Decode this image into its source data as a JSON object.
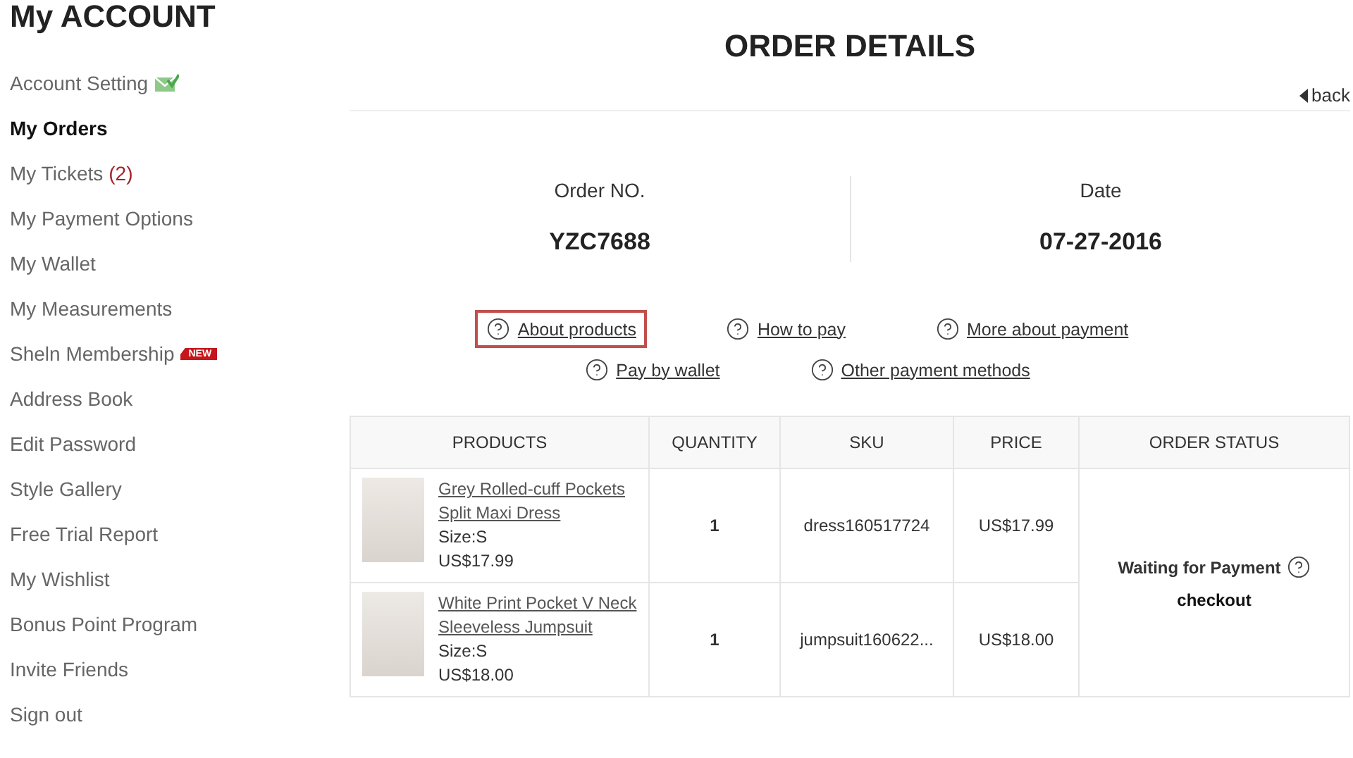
{
  "sidebar": {
    "title": "My ACCOUNT",
    "items": [
      {
        "label": "Account Setting",
        "kind": "mail",
        "selected": false
      },
      {
        "label": "My Orders",
        "kind": "plain",
        "selected": true
      },
      {
        "label": "My Tickets",
        "kind": "count",
        "count": "(2)",
        "selected": false
      },
      {
        "label": "My Payment Options",
        "kind": "plain",
        "selected": false
      },
      {
        "label": "My Wallet",
        "kind": "plain",
        "selected": false
      },
      {
        "label": "My Measurements",
        "kind": "plain",
        "selected": false
      },
      {
        "label": "Sheln Membership",
        "kind": "badge",
        "badge": "NEW",
        "selected": false
      },
      {
        "label": "Address Book",
        "kind": "plain",
        "selected": false
      },
      {
        "label": "Edit Password",
        "kind": "plain",
        "selected": false
      },
      {
        "label": "Style Gallery",
        "kind": "plain",
        "selected": false
      },
      {
        "label": "Free Trial Report",
        "kind": "plain",
        "selected": false
      },
      {
        "label": "My Wishlist",
        "kind": "plain",
        "selected": false
      },
      {
        "label": "Bonus Point Program",
        "kind": "plain",
        "selected": false
      },
      {
        "label": "Invite Friends",
        "kind": "plain",
        "selected": false
      },
      {
        "label": "Sign out",
        "kind": "plain",
        "selected": false
      }
    ]
  },
  "page": {
    "title": "ORDER DETAILS",
    "back": "back"
  },
  "order": [
    {
      "label": "Order NO.",
      "value": "YZC7688"
    },
    {
      "label": "Date",
      "value": "07-27-2016"
    }
  ],
  "help_links": [
    [
      {
        "label": "About products",
        "highlighted": true
      },
      {
        "label": "How to pay",
        "highlighted": false
      },
      {
        "label": "More about payment",
        "highlighted": false
      }
    ],
    [
      {
        "label": "Pay by wallet",
        "highlighted": false
      },
      {
        "label": "Other payment methods",
        "highlighted": false
      }
    ]
  ],
  "table": {
    "columns": [
      "PRODUCTS",
      "QUANTITY",
      "SKU",
      "PRICE",
      "ORDER STATUS"
    ],
    "rows": [
      {
        "name": "Grey Rolled-cuff Pockets Split Maxi Dress",
        "size": "Size:S",
        "unit_price": "US$17.99",
        "quantity": "1",
        "sku": "dress160517724",
        "price": "US$17.99"
      },
      {
        "name": "White Print Pocket V Neck Sleeveless Jumpsuit",
        "size": "Size:S",
        "unit_price": "US$18.00",
        "quantity": "1",
        "sku": "jumpsuit160622...",
        "price": "US$18.00"
      }
    ],
    "status": {
      "text": "Waiting for Payment",
      "action": "checkout"
    }
  }
}
